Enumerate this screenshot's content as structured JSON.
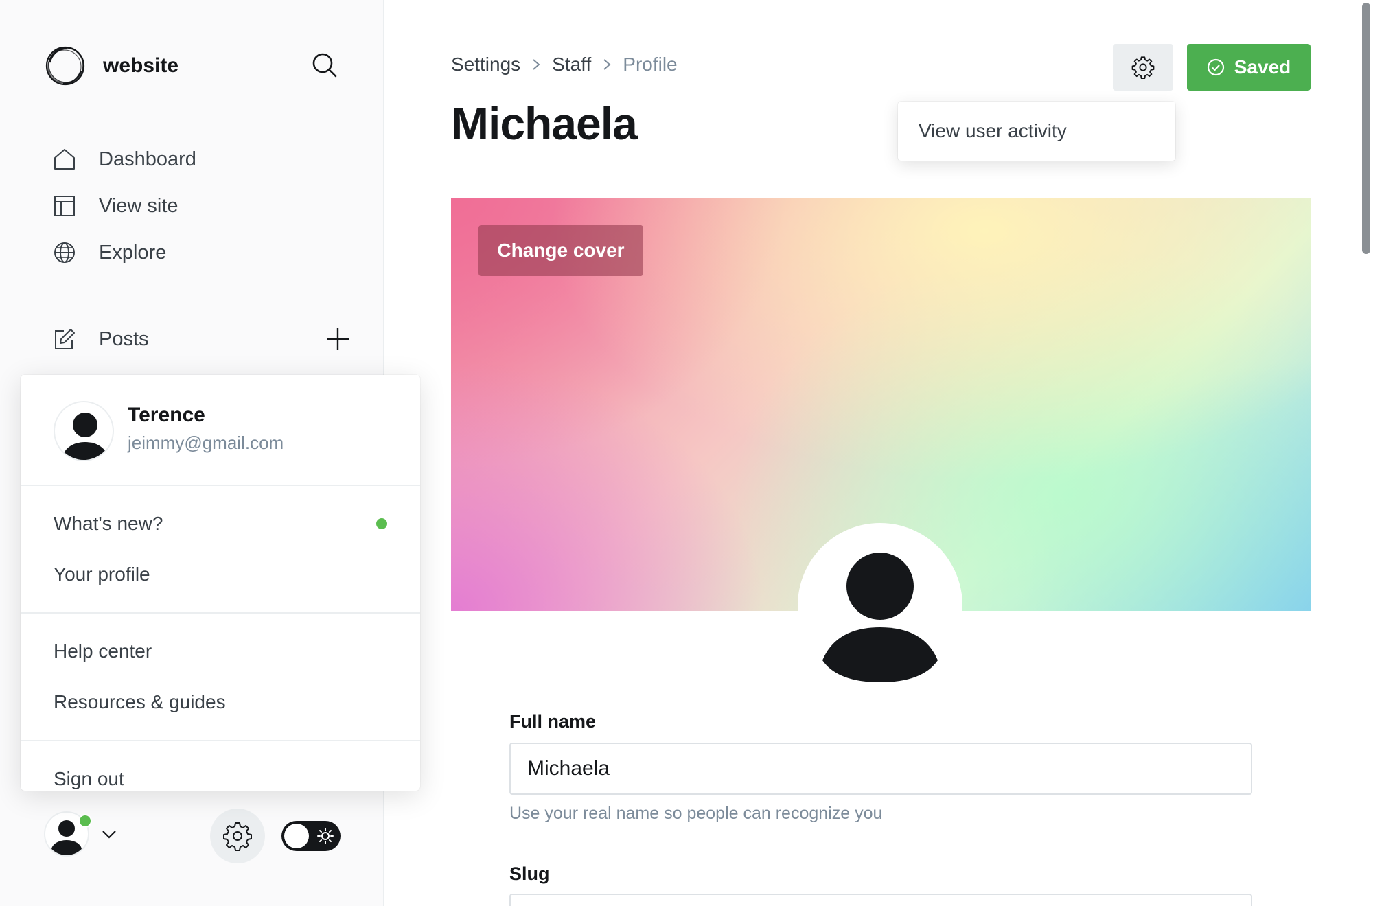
{
  "brand": {
    "name": "website"
  },
  "sidebar": {
    "nav": [
      {
        "label": "Dashboard",
        "icon": "home-icon"
      },
      {
        "label": "View site",
        "icon": "layout-icon"
      },
      {
        "label": "Explore",
        "icon": "globe-icon"
      }
    ],
    "posts": {
      "label": "Posts",
      "icon": "edit-icon"
    }
  },
  "user_menu": {
    "name": "Terence",
    "email": "jeimmy@gmail.com",
    "items": [
      {
        "label": "What's new?",
        "has_dot": true
      },
      {
        "label": "Your profile"
      },
      {
        "label": "Help center"
      },
      {
        "label": "Resources & guides"
      },
      {
        "label": "Sign out"
      }
    ]
  },
  "breadcrumb": {
    "items": [
      "Settings",
      "Staff"
    ],
    "current": "Profile"
  },
  "page": {
    "title": "Michaela"
  },
  "toolbar": {
    "saved_label": "Saved"
  },
  "activity_menu": {
    "item": "View user activity"
  },
  "cover": {
    "change_label": "Change cover"
  },
  "form": {
    "full_name": {
      "label": "Full name",
      "value": "Michaela",
      "hint": "Use your real name so people can recognize you"
    },
    "slug": {
      "label": "Slug"
    }
  },
  "colors": {
    "accent_green": "#4caf50",
    "online_dot": "#5bbd4f",
    "text_primary": "#15171a",
    "text_muted": "#7c8b9a"
  }
}
